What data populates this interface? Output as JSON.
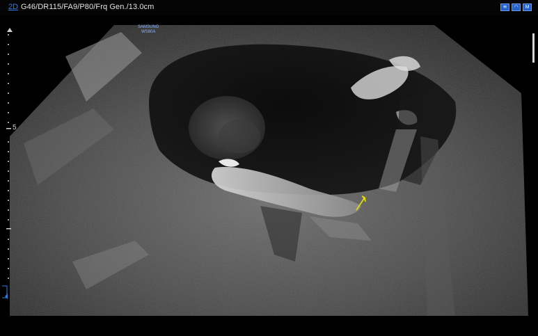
{
  "topbar": {
    "mode": "2D",
    "parameters": "G46/DR115/FA9/P80/Frq Gen./13.0cm",
    "icons": [
      {
        "name": "harmonic-mode-icon",
        "label": "Har"
      },
      {
        "name": "probe-icon",
        "label": ""
      },
      {
        "name": "measure-icon",
        "label": "M"
      }
    ]
  },
  "image": {
    "brand_line1": "SAMSUNG",
    "brand_line2": "WS80A",
    "depth_marker": "5",
    "arrow_color": "#e8e000"
  }
}
